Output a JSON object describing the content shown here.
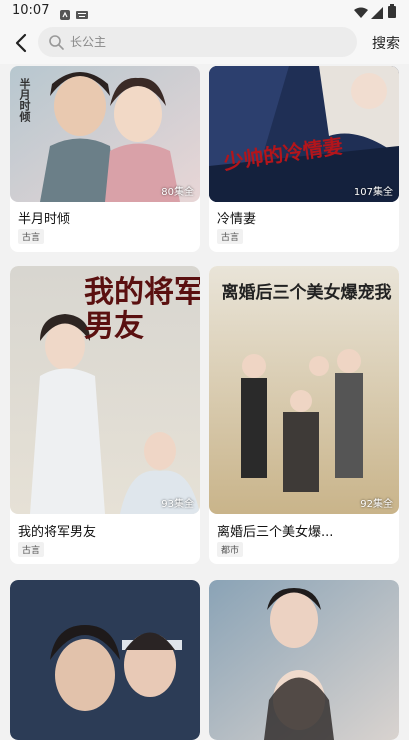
{
  "status": {
    "time": "10:07"
  },
  "search": {
    "placeholder": "长公主",
    "button_label": "搜索"
  },
  "results": [
    {
      "title": "半月时倾",
      "episodes": "80集全",
      "tag": "古言",
      "poster_text": "半月时倾"
    },
    {
      "title": "冷情妻",
      "episodes": "107集全",
      "tag": "古言",
      "poster_text": "少帅的冷情妻"
    },
    {
      "title": "我的将军男友",
      "episodes": "93集全",
      "tag": "古言",
      "poster_text": "我的将军男友"
    },
    {
      "title": "离婚后三个美女爆...",
      "episodes": "92集全",
      "tag": "都市",
      "poster_text": "离婚后三个美女爆宠我"
    },
    {
      "title": "",
      "episodes": "",
      "tag": ""
    },
    {
      "title": "",
      "episodes": "",
      "tag": ""
    }
  ]
}
